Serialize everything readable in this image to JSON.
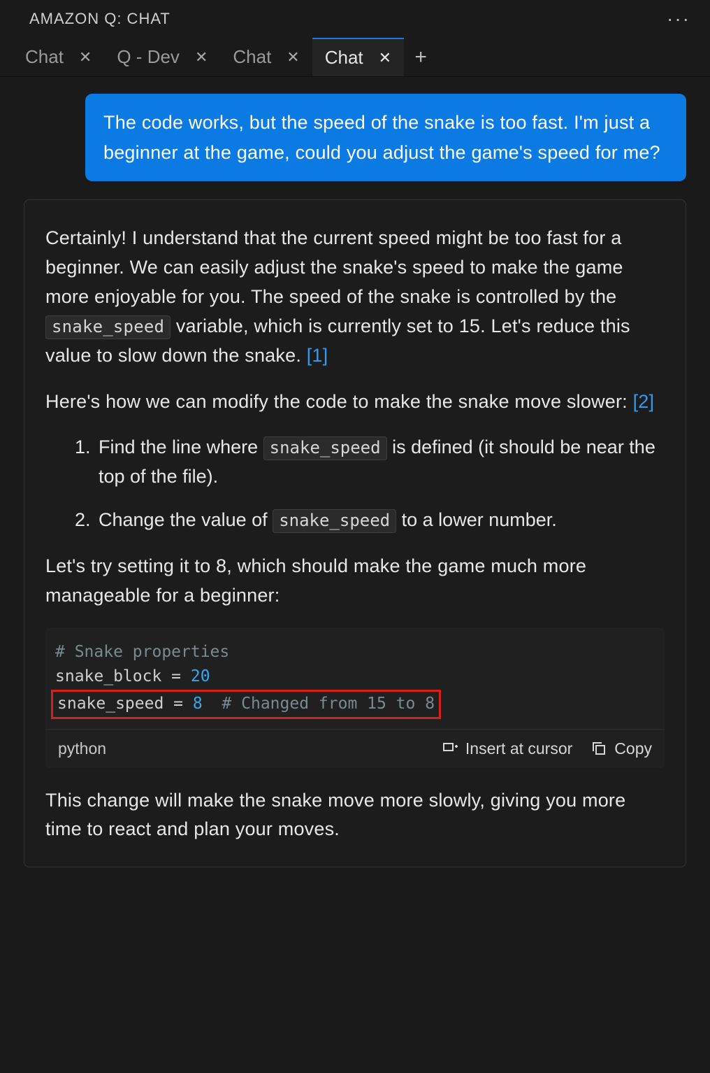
{
  "panel": {
    "title": "AMAZON Q: CHAT"
  },
  "tabs": {
    "items": [
      {
        "label": "Chat",
        "active": false
      },
      {
        "label": "Q - Dev",
        "active": false
      },
      {
        "label": "Chat",
        "active": false
      },
      {
        "label": "Chat",
        "active": true
      }
    ]
  },
  "chat": {
    "user_message": "The code works, but the speed of the snake is too fast. I'm just a beginner at the game, could you adjust the game's speed for me?",
    "assistant": {
      "p1_a": "Certainly! I understand that the current speed might be too fast for a beginner. We can easily adjust the snake's speed to make the game more enjoyable for you. The speed of the snake is controlled by the ",
      "p1_code": "snake_speed",
      "p1_b": " variable, which is currently set to 15. Let's reduce this value to slow down the snake. ",
      "ref1": "[1]",
      "p2_a": "Here's how we can modify the code to make the snake move slower: ",
      "ref2": "[2]",
      "li1_a": "Find the line where ",
      "li1_code": "snake_speed",
      "li1_b": " is defined (it should be near the top of the file).",
      "li2_a": "Change the value of ",
      "li2_code": "snake_speed",
      "li2_b": " to a lower number.",
      "p3": "Let's try setting it to 8, which should make the game much more manageable for a beginner:",
      "code_block": {
        "lines": {
          "l1_comment": "# Snake properties",
          "l2_var": "snake_block",
          "l2_eq": " = ",
          "l2_val": "20",
          "l3_var": "snake_speed",
          "l3_eq": " = ",
          "l3_val": "8",
          "l3_comment": "  # Changed from 15 to 8"
        },
        "language": "python",
        "insert_label": "Insert at cursor",
        "copy_label": "Copy"
      },
      "p4": "This change will make the snake move more slowly, giving you more time to react and plan your moves."
    }
  }
}
